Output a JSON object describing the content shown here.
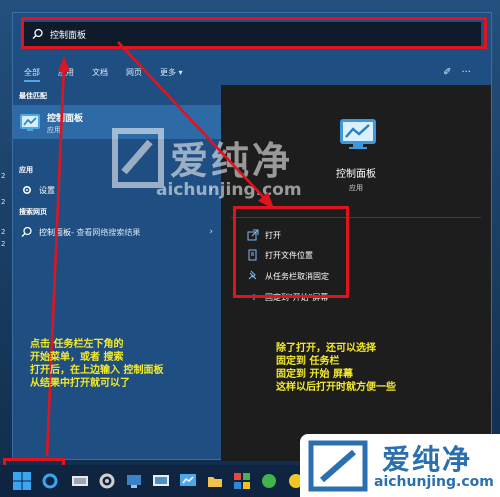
{
  "search": {
    "query": "控制面板"
  },
  "tabs": [
    {
      "label": "全部"
    },
    {
      "label": "应用"
    },
    {
      "label": "文档"
    },
    {
      "label": "网页"
    },
    {
      "label": "更多"
    }
  ],
  "left": {
    "best_match_label": "最佳匹配",
    "best_match": {
      "title": "控制面板",
      "subtitle": "应用"
    },
    "apps_label": "应用",
    "apps_item": "设置",
    "web_label": "搜索网页",
    "web_item": {
      "query": "控制面板",
      "suffix": " - 查看网络搜索结果"
    }
  },
  "preview": {
    "title": "控制面板",
    "subtitle": "应用",
    "actions": [
      {
        "label": "打开",
        "icon": "open-icon"
      },
      {
        "label": "打开文件位置",
        "icon": "folder-icon"
      },
      {
        "label": "从任务栏取消固定",
        "icon": "unpin-icon"
      },
      {
        "label": "固定到\"开始\"屏幕",
        "icon": "pin-icon"
      }
    ]
  },
  "desktop_numbers": [
    "2",
    "2",
    "2",
    "2"
  ],
  "notes": {
    "left": [
      "点击 任务栏左下角的",
      "开始菜单，或者 搜索",
      "打开后，在上边输入 控制面板",
      "从结果中打开就可以了"
    ],
    "right": [
      "除了打开，还可以选择",
      "固定到 任务栏",
      "固定到 开始 屏幕",
      "这样以后打开时就方便一些"
    ]
  },
  "watermark": {
    "brand": "爱纯净",
    "url": "aichunjing.com"
  },
  "colors": {
    "accent": "#5aa2e6",
    "annotation_red": "#e0141e",
    "annotation_text": "#f3ea2b"
  }
}
